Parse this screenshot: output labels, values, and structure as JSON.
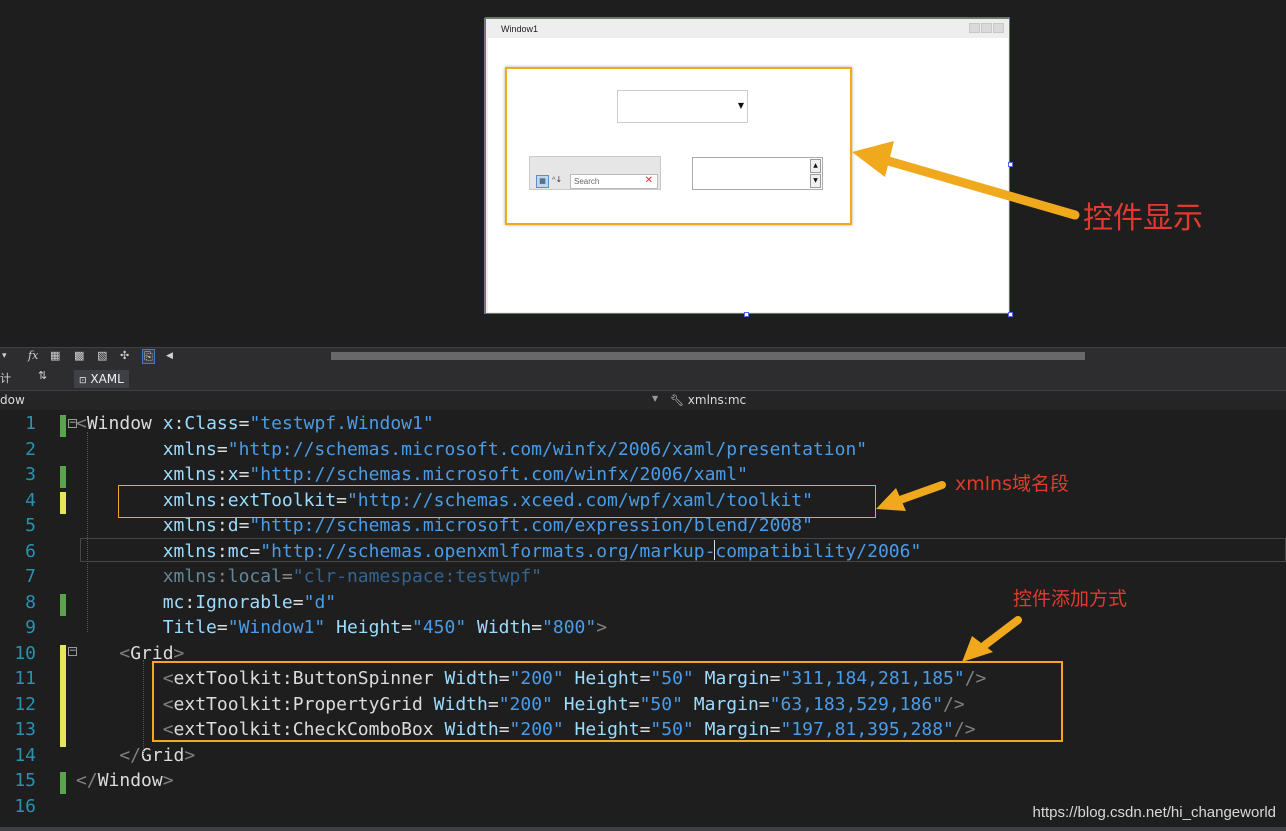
{
  "designer": {
    "window_title": "Window1",
    "property_grid_search_placeholder": "Search",
    "annotation": "控件显示"
  },
  "toolbar": {
    "fx_label": "fx",
    "tab_label": "XAML",
    "sort_label": "⇅",
    "left_fragment": "计"
  },
  "nav": {
    "left": "dow",
    "right": "xmlns:mc"
  },
  "editor": {
    "line_numbers": [
      "1",
      "2",
      "3",
      "4",
      "5",
      "6",
      "7",
      "8",
      "9",
      "10",
      "11",
      "12",
      "13",
      "14",
      "15",
      "16"
    ],
    "annotations": {
      "xmlns": "xmlns域名段",
      "add": "控件添加方式"
    },
    "lines": [
      [
        {
          "t": "<",
          "k": "b"
        },
        {
          "t": "Window",
          "k": "el"
        },
        {
          "t": " x",
          "k": "at"
        },
        {
          "t": ":",
          "k": "p"
        },
        {
          "t": "Class",
          "k": "at"
        },
        {
          "t": "=",
          "k": "p"
        },
        {
          "t": "\"testwpf.Window1\"",
          "k": "v"
        }
      ],
      [
        {
          "t": "        xmlns",
          "k": "at"
        },
        {
          "t": "=",
          "k": "p"
        },
        {
          "t": "\"http://schemas.microsoft.com/winfx/2006/xaml/presentation\"",
          "k": "v"
        }
      ],
      [
        {
          "t": "        xmlns",
          "k": "at"
        },
        {
          "t": ":",
          "k": "p"
        },
        {
          "t": "x",
          "k": "at"
        },
        {
          "t": "=",
          "k": "p"
        },
        {
          "t": "\"http://schemas.microsoft.com/winfx/2006/xaml\"",
          "k": "v"
        }
      ],
      [
        {
          "t": "        xmlns",
          "k": "at"
        },
        {
          "t": ":",
          "k": "p"
        },
        {
          "t": "extToolkit",
          "k": "at"
        },
        {
          "t": "=",
          "k": "p"
        },
        {
          "t": "\"http://schemas.xceed.com/wpf/xaml/toolkit\"",
          "k": "v"
        }
      ],
      [
        {
          "t": "        xmlns",
          "k": "at"
        },
        {
          "t": ":",
          "k": "p"
        },
        {
          "t": "d",
          "k": "at"
        },
        {
          "t": "=",
          "k": "p"
        },
        {
          "t": "\"http://schemas.microsoft.com/expression/blend/2008\"",
          "k": "v"
        }
      ],
      [
        {
          "t": "        xmlns",
          "k": "at"
        },
        {
          "t": ":",
          "k": "p"
        },
        {
          "t": "mc",
          "k": "at"
        },
        {
          "t": "=",
          "k": "p"
        },
        {
          "t": "\"http://schemas.openxmlformats.org/markup-compatibility/2006\"",
          "k": "v"
        }
      ],
      [
        {
          "t": "        xmlns",
          "k": "atd"
        },
        {
          "t": ":",
          "k": "pd"
        },
        {
          "t": "local",
          "k": "atd"
        },
        {
          "t": "=",
          "k": "pd"
        },
        {
          "t": "\"clr-namespace:testwpf\"",
          "k": "vd"
        }
      ],
      [
        {
          "t": "        mc",
          "k": "at"
        },
        {
          "t": ":",
          "k": "p"
        },
        {
          "t": "Ignorable",
          "k": "at"
        },
        {
          "t": "=",
          "k": "p"
        },
        {
          "t": "\"d\"",
          "k": "v"
        }
      ],
      [
        {
          "t": "        Title",
          "k": "at"
        },
        {
          "t": "=",
          "k": "p"
        },
        {
          "t": "\"Window1\"",
          "k": "v"
        },
        {
          "t": " Height",
          "k": "at"
        },
        {
          "t": "=",
          "k": "p"
        },
        {
          "t": "\"450\"",
          "k": "v"
        },
        {
          "t": " Width",
          "k": "at"
        },
        {
          "t": "=",
          "k": "p"
        },
        {
          "t": "\"800\"",
          "k": "v"
        },
        {
          "t": ">",
          "k": "b"
        }
      ],
      [
        {
          "t": "    <",
          "k": "b"
        },
        {
          "t": "Grid",
          "k": "el"
        },
        {
          "t": ">",
          "k": "b"
        }
      ],
      [
        {
          "t": "        <",
          "k": "b"
        },
        {
          "t": "extToolkit",
          "k": "el"
        },
        {
          "t": ":",
          "k": "p"
        },
        {
          "t": "ButtonSpinner",
          "k": "el"
        },
        {
          "t": " Width",
          "k": "at"
        },
        {
          "t": "=",
          "k": "p"
        },
        {
          "t": "\"200\"",
          "k": "v"
        },
        {
          "t": " Height",
          "k": "at"
        },
        {
          "t": "=",
          "k": "p"
        },
        {
          "t": "\"50\"",
          "k": "v"
        },
        {
          "t": " Margin",
          "k": "at"
        },
        {
          "t": "=",
          "k": "p"
        },
        {
          "t": "\"311,184,281,185\"",
          "k": "v"
        },
        {
          "t": "/>",
          "k": "b"
        }
      ],
      [
        {
          "t": "        <",
          "k": "b"
        },
        {
          "t": "extToolkit",
          "k": "el"
        },
        {
          "t": ":",
          "k": "p"
        },
        {
          "t": "PropertyGrid",
          "k": "el"
        },
        {
          "t": " Width",
          "k": "at"
        },
        {
          "t": "=",
          "k": "p"
        },
        {
          "t": "\"200\"",
          "k": "v"
        },
        {
          "t": " Height",
          "k": "at"
        },
        {
          "t": "=",
          "k": "p"
        },
        {
          "t": "\"50\"",
          "k": "v"
        },
        {
          "t": " Margin",
          "k": "at"
        },
        {
          "t": "=",
          "k": "p"
        },
        {
          "t": "\"63,183,529,186\"",
          "k": "v"
        },
        {
          "t": "/>",
          "k": "b"
        }
      ],
      [
        {
          "t": "        <",
          "k": "b"
        },
        {
          "t": "extToolkit",
          "k": "el"
        },
        {
          "t": ":",
          "k": "p"
        },
        {
          "t": "CheckComboBox",
          "k": "el"
        },
        {
          "t": " Width",
          "k": "at"
        },
        {
          "t": "=",
          "k": "p"
        },
        {
          "t": "\"200\"",
          "k": "v"
        },
        {
          "t": " Height",
          "k": "at"
        },
        {
          "t": "=",
          "k": "p"
        },
        {
          "t": "\"50\"",
          "k": "v"
        },
        {
          "t": " Margin",
          "k": "at"
        },
        {
          "t": "=",
          "k": "p"
        },
        {
          "t": "\"197,81,395,288\"",
          "k": "v"
        },
        {
          "t": "/>",
          "k": "b"
        }
      ],
      [
        {
          "t": "    </",
          "k": "b"
        },
        {
          "t": "Grid",
          "k": "el"
        },
        {
          "t": ">",
          "k": "b"
        }
      ],
      [
        {
          "t": "</",
          "k": "b"
        },
        {
          "t": "Window",
          "k": "el"
        },
        {
          "t": ">",
          "k": "b"
        }
      ],
      []
    ]
  },
  "watermark": "https://blog.csdn.net/hi_changeworld",
  "colors": {
    "accent_orange": "#f0a81c",
    "annotation_red": "#e23a2e",
    "line_number": "#2b91af",
    "string_value": "#4a9ce8",
    "attribute": "#9cdcfe"
  }
}
